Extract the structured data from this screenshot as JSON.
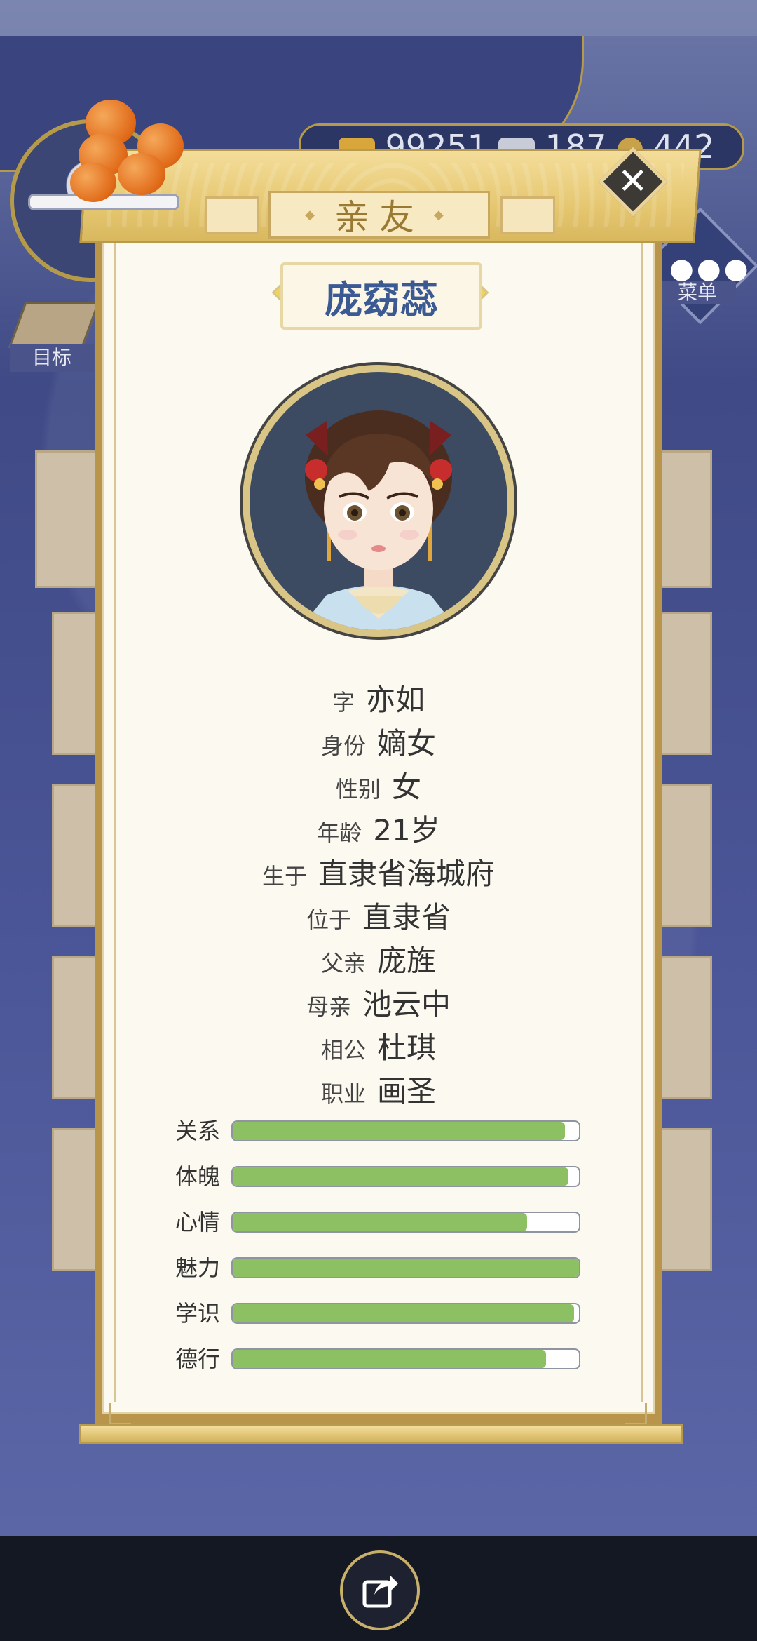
{
  "hud": {
    "currency_gold": "99251",
    "currency_silver": "187",
    "currency_coin": "442",
    "menu_label": "菜单",
    "goal_label": "目标"
  },
  "dialog": {
    "title": "亲友",
    "name": "庞窈蕊",
    "close_symbol": "✕"
  },
  "profile": [
    {
      "label": "字",
      "value": "亦如"
    },
    {
      "label": "身份",
      "value": "嫡女"
    },
    {
      "label": "性别",
      "value": "女"
    },
    {
      "label": "年龄",
      "value": "21岁"
    },
    {
      "label": "生于",
      "value": "直隶省海城府"
    },
    {
      "label": "位于",
      "value": "直隶省"
    },
    {
      "label": "父亲",
      "value": "庞旌"
    },
    {
      "label": "母亲",
      "value": "池云中"
    },
    {
      "label": "相公",
      "value": "杜琪"
    },
    {
      "label": "职业",
      "value": "画圣"
    }
  ],
  "stats": [
    {
      "label": "关系",
      "fill": 0.96
    },
    {
      "label": "体魄",
      "fill": 0.97
    },
    {
      "label": "心情",
      "fill": 0.85
    },
    {
      "label": "魅力",
      "fill": 1.0
    },
    {
      "label": "学识",
      "fill": 0.985
    },
    {
      "label": "德行",
      "fill": 0.905
    }
  ],
  "colors": {
    "stat_fill": "#8cc063",
    "name_text": "#3b5a94",
    "panel_gold": "#b8954a"
  },
  "icons": {
    "close": "close-icon",
    "share": "share-icon",
    "menu": "menu-dots-icon",
    "goal": "scroll-icon"
  }
}
